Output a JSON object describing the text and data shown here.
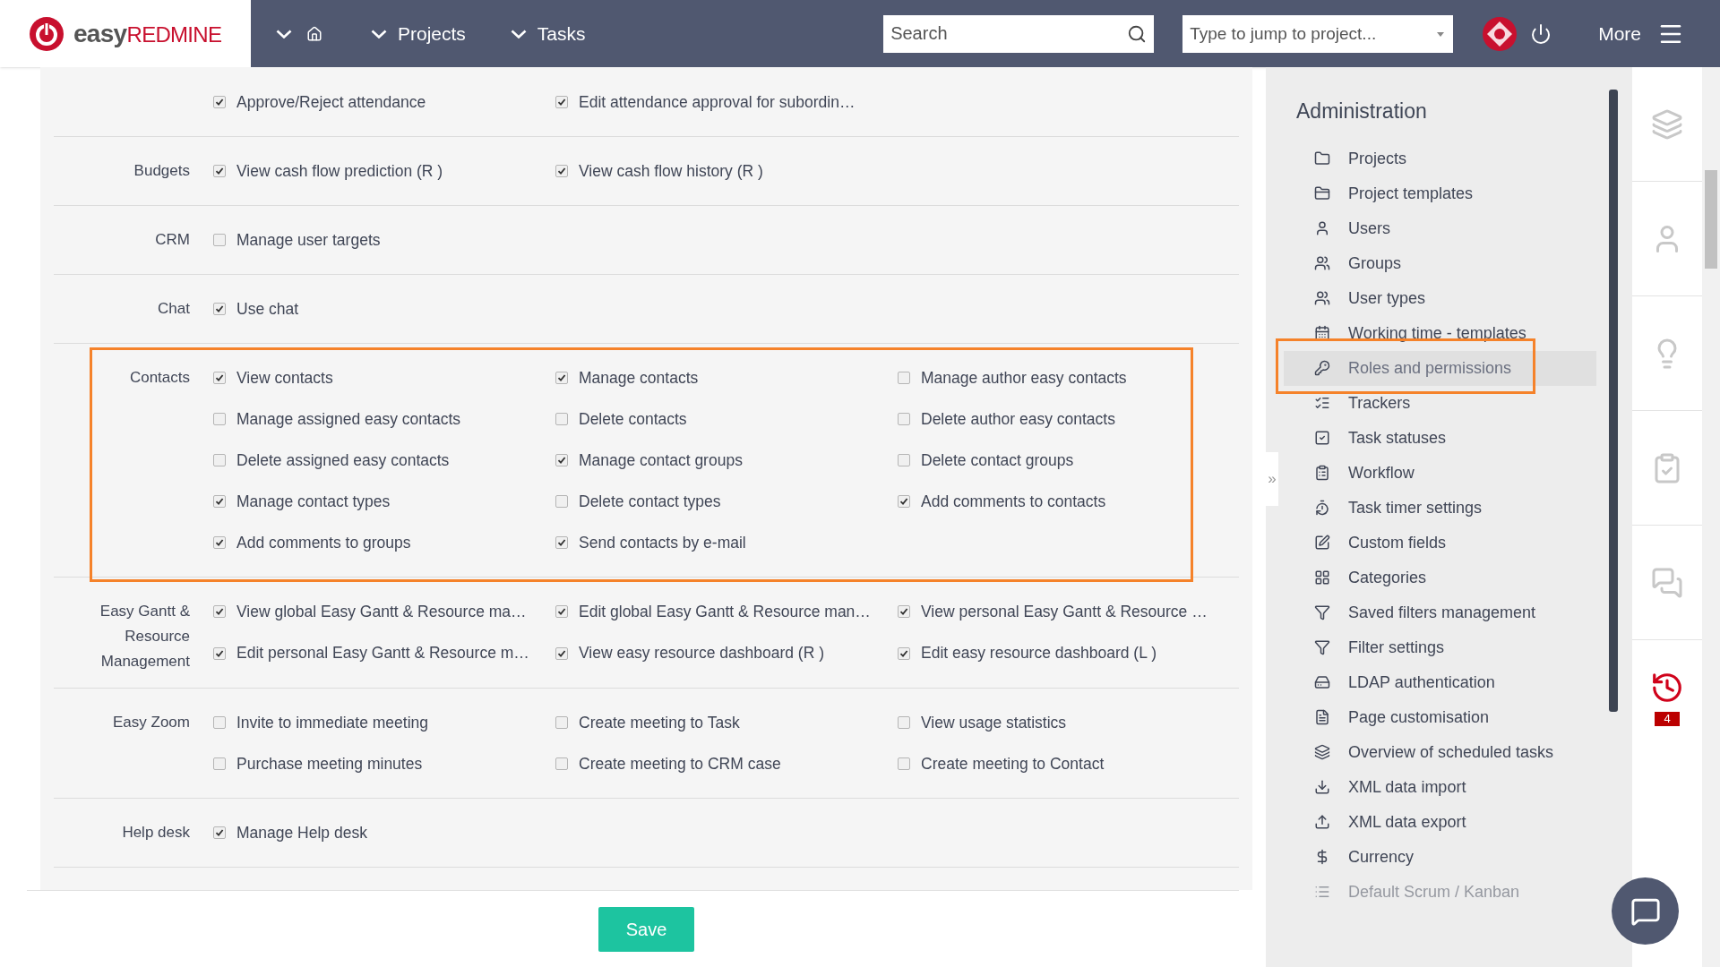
{
  "header": {
    "logo": {
      "part_1": "easy",
      "part_2": "REDMINE"
    },
    "nav": [
      {
        "label": "Projects"
      },
      {
        "label": "Tasks"
      }
    ],
    "search": {
      "placeholder": "Search"
    },
    "jump": {
      "placeholder": "Type to jump to project..."
    },
    "more": "More"
  },
  "permissions": [
    {
      "highlighted": false,
      "items": [
        {
          "label": "Approve/Reject attendance",
          "checked": true
        },
        {
          "label": "Edit attendance approval for subordin…",
          "checked": true
        }
      ]
    },
    {
      "label": "Budgets",
      "highlighted": false,
      "items": [
        {
          "label": "View cash flow prediction (R )",
          "checked": true
        },
        {
          "label": "View cash flow history (R )",
          "checked": true
        }
      ]
    },
    {
      "label": "CRM",
      "highlighted": false,
      "items": [
        {
          "label": "Manage user targets",
          "checked": false
        }
      ]
    },
    {
      "label": "Chat",
      "highlighted": false,
      "items": [
        {
          "label": "Use chat",
          "checked": true
        }
      ]
    },
    {
      "label": "Contacts",
      "highlighted": true,
      "items": [
        {
          "label": "View contacts",
          "checked": true
        },
        {
          "label": "Manage contacts",
          "checked": true
        },
        {
          "label": "Manage author easy contacts",
          "checked": false
        },
        {
          "label": "Manage assigned easy contacts",
          "checked": false
        },
        {
          "label": "Delete contacts",
          "checked": false
        },
        {
          "label": "Delete author easy contacts",
          "checked": false
        },
        {
          "label": "Delete assigned easy contacts",
          "checked": false
        },
        {
          "label": "Manage contact groups",
          "checked": true
        },
        {
          "label": "Delete contact groups",
          "checked": false
        },
        {
          "label": "Manage contact types",
          "checked": true
        },
        {
          "label": "Delete contact types",
          "checked": false
        },
        {
          "label": "Add comments to contacts",
          "checked": true
        },
        {
          "label": "Add comments to groups",
          "checked": true
        },
        {
          "label": "Send contacts by e-mail",
          "checked": true
        }
      ]
    },
    {
      "label": "Easy Gantt & Resource Management",
      "highlighted": false,
      "items": [
        {
          "label": "View global Easy Gantt & Resource ma…",
          "checked": true
        },
        {
          "label": "Edit global Easy Gantt & Resource man…",
          "checked": true
        },
        {
          "label": "View personal Easy Gantt & Resource …",
          "checked": true
        },
        {
          "label": "Edit personal Easy Gantt & Resource m…",
          "checked": true
        },
        {
          "label": "View easy resource dashboard (R )",
          "checked": true
        },
        {
          "label": "Edit easy resource dashboard (L )",
          "checked": true
        }
      ]
    },
    {
      "label": "Easy Zoom",
      "highlighted": false,
      "items": [
        {
          "label": "Invite to immediate meeting",
          "checked": false
        },
        {
          "label": "Create meeting to Task",
          "checked": false
        },
        {
          "label": "View usage statistics",
          "checked": false
        },
        {
          "label": "Purchase meeting minutes",
          "checked": false
        },
        {
          "label": "Create meeting to CRM case",
          "checked": false
        },
        {
          "label": "Create meeting to Contact",
          "checked": false
        }
      ]
    },
    {
      "label": "Help desk",
      "highlighted": false,
      "items": [
        {
          "label": "Manage Help desk",
          "checked": true
        }
      ]
    }
  ],
  "save": "Save",
  "sidebar": {
    "title": "Administration",
    "items": [
      {
        "label": "Projects",
        "selected": false,
        "highlighted": false
      },
      {
        "label": "Project templates",
        "selected": false,
        "highlighted": false
      },
      {
        "label": "Users",
        "selected": false,
        "highlighted": false
      },
      {
        "label": "Groups",
        "selected": false,
        "highlighted": false
      },
      {
        "label": "User types",
        "selected": false,
        "highlighted": false
      },
      {
        "label": "Working time - templates",
        "selected": false,
        "highlighted": false
      },
      {
        "label": "Roles and permissions",
        "selected": true,
        "highlighted": true
      },
      {
        "label": "Trackers",
        "selected": false,
        "highlighted": false
      },
      {
        "label": "Task statuses",
        "selected": false,
        "highlighted": false
      },
      {
        "label": "Workflow",
        "selected": false,
        "highlighted": false
      },
      {
        "label": "Task timer settings",
        "selected": false,
        "highlighted": false
      },
      {
        "label": "Custom fields",
        "selected": false,
        "highlighted": false
      },
      {
        "label": "Categories",
        "selected": false,
        "highlighted": false
      },
      {
        "label": "Saved filters management",
        "selected": false,
        "highlighted": false
      },
      {
        "label": "Filter settings",
        "selected": false,
        "highlighted": false
      },
      {
        "label": "LDAP authentication",
        "selected": false,
        "highlighted": false
      },
      {
        "label": "Page customisation",
        "selected": false,
        "highlighted": false
      },
      {
        "label": "Overview of scheduled tasks",
        "selected": false,
        "highlighted": false
      },
      {
        "label": "XML data import",
        "selected": false,
        "highlighted": false
      },
      {
        "label": "XML data export",
        "selected": false,
        "highlighted": false
      },
      {
        "label": "Currency",
        "selected": false,
        "highlighted": false
      },
      {
        "label": "Default Scrum / Kanban",
        "selected": false,
        "highlighted": false
      }
    ]
  },
  "collapse": "»",
  "history_badge": "4"
}
